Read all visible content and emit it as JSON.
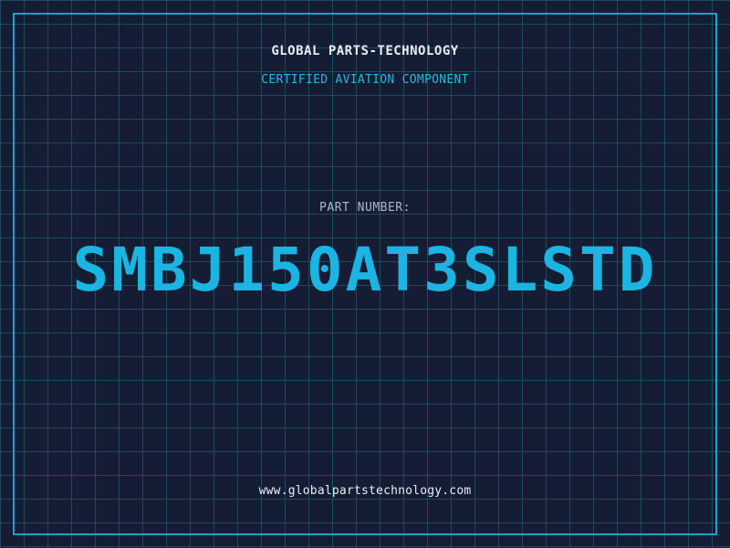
{
  "header": {
    "company": "GLOBAL PARTS-TECHNOLOGY",
    "subtitle": "CERTIFIED AVIATION COMPONENT"
  },
  "part": {
    "label": "PART NUMBER:",
    "number": "SMBJ150AT3SLSTD"
  },
  "footer": {
    "website": "www.globalpartstechnology.com"
  },
  "colors": {
    "background": "#141d33",
    "grid": "#1e4a62",
    "accent": "#1cb4e2",
    "text": "#e8eef5"
  }
}
